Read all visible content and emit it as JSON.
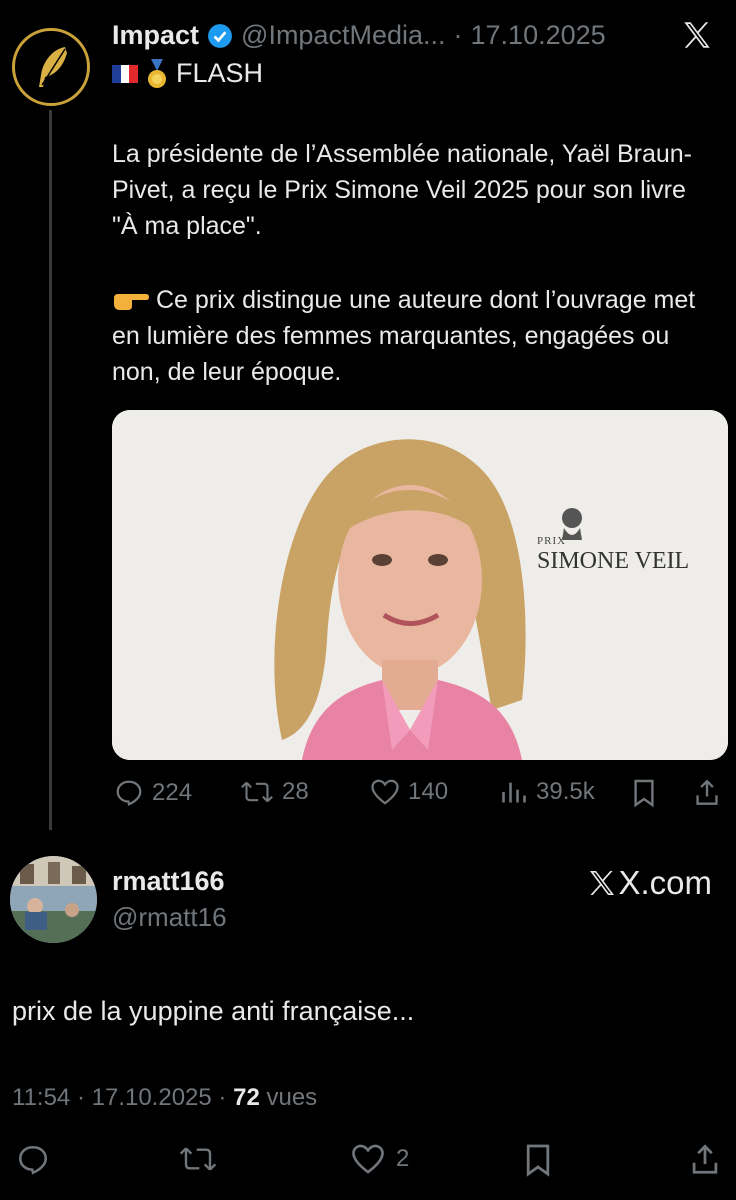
{
  "quoted_tweet": {
    "author_name": "Impact",
    "author_handle": "@ImpactMedia...",
    "separator": "·",
    "date": "17.10.2025",
    "tag": "FLASH",
    "paragraph1": "La présidente de l’Assemblée nationale, Yaël Braun-Pivet, a reçu le Prix Simone Veil 2025 pour son livre \"À ma place\".",
    "paragraph2": "Ce prix distingue une auteure dont l’ouvrage met en lumière des femmes marquantes, engagées ou non, de leur époque.",
    "image_prix_small": "PRIX",
    "image_prix_title": "SIMONE VEIL",
    "stats": {
      "replies": "224",
      "reposts": "28",
      "likes": "140",
      "views": "39.5k"
    }
  },
  "reply": {
    "author_name": "rmatt166",
    "author_handle": "@rmatt16",
    "text": "prix de la yuppine anti française...",
    "time": "11:54",
    "date": "17.10.2025",
    "views_count": "72",
    "views_label": "vues",
    "likes": "2"
  },
  "brand_label": "X.com",
  "colors": {
    "background": "#000000",
    "text": "#e7e9ea",
    "muted": "#71767b",
    "verified": "#1d9bf0",
    "gold": "#c9a23a"
  },
  "icons": [
    "feather-logo",
    "verified-badge-icon",
    "x-logo-icon",
    "france-flag-icon",
    "medal-icon",
    "pointing-hand-icon",
    "reply-icon",
    "repost-icon",
    "like-icon",
    "views-icon",
    "bookmark-icon",
    "share-icon"
  ]
}
